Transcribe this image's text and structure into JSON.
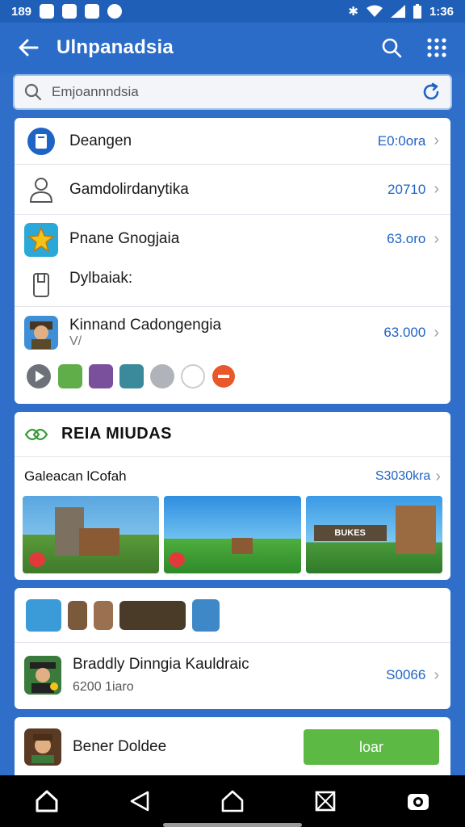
{
  "status_bar": {
    "time": "1:36",
    "left_text": "189"
  },
  "app_bar": {
    "title": "Ulnpanadsia"
  },
  "search": {
    "placeholder": "Emjoannndsia"
  },
  "list": [
    {
      "title": "Deangen",
      "value": "E0:0ora"
    },
    {
      "title": "Gamdolirdanytika",
      "value": "20710"
    },
    {
      "title": "Pnane Gnogjaia",
      "value": "63.oro"
    },
    {
      "title": "Dylbaiak:",
      "value": ""
    },
    {
      "title": "Kinnand Cadongengia",
      "value": "63.000",
      "sub": "V/"
    }
  ],
  "section": {
    "title": "REIA MIUDAS"
  },
  "gallery": {
    "title": "Galeacan lCofah",
    "value": "S3030kra",
    "banner_text": "BUKES"
  },
  "featured": {
    "title": "Braddly Dinngia Kauldraic",
    "subtitle": "6200 1iaro",
    "value": "S0066"
  },
  "bottom_item": {
    "title": "Bener Doldee",
    "button": "loar"
  },
  "colors": {
    "primary": "#2b6cc8",
    "accent": "#1f63c5",
    "button": "#5cb944"
  }
}
